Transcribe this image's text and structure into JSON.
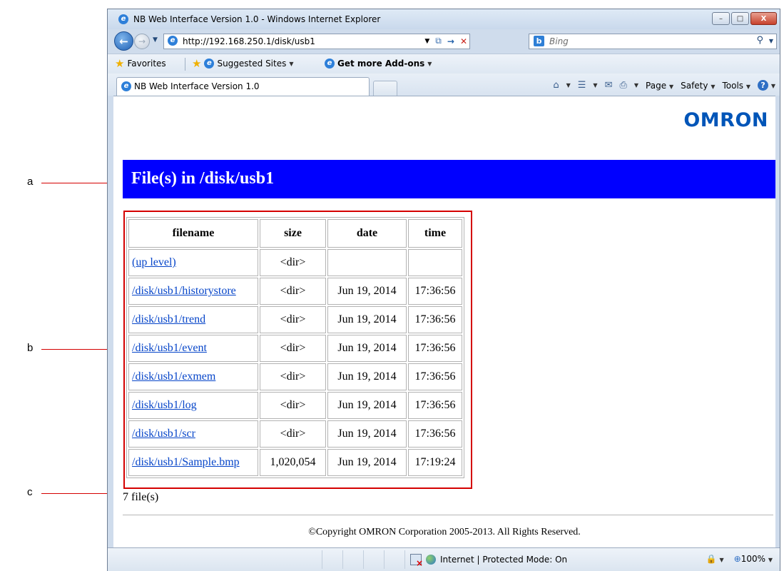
{
  "callouts": {
    "a": "a",
    "b": "b",
    "c": "c"
  },
  "window": {
    "title": "NB Web Interface Version 1.0 - Windows Internet Explorer",
    "controls": {
      "minimize": "–",
      "maximize": "□",
      "close": "X"
    }
  },
  "address_bar": {
    "url": "http://192.168.250.1/disk/usb1",
    "search_placeholder": "Bing"
  },
  "favorites_bar": {
    "favorites_label": "Favorites",
    "suggested_sites_label": "Suggested Sites",
    "addons_label": "Get more Add-ons"
  },
  "tabs": [
    {
      "label": "NB Web Interface Version 1.0",
      "active": true
    }
  ],
  "command_bar": {
    "page_label": "Page",
    "safety_label": "Safety",
    "tools_label": "Tools"
  },
  "page": {
    "logo": "OMRON",
    "heading": "File(s) in /disk/usb1",
    "table": {
      "headers": [
        "filename",
        "size",
        "date",
        "time"
      ],
      "rows": [
        {
          "filename": "(up level)",
          "size": "<dir>",
          "date": "",
          "time": ""
        },
        {
          "filename": "/disk/usb1/historystore",
          "size": "<dir>",
          "date": "Jun 19, 2014",
          "time": "17:36:56"
        },
        {
          "filename": "/disk/usb1/trend",
          "size": "<dir>",
          "date": "Jun 19, 2014",
          "time": "17:36:56"
        },
        {
          "filename": "/disk/usb1/event",
          "size": "<dir>",
          "date": "Jun 19, 2014",
          "time": "17:36:56"
        },
        {
          "filename": "/disk/usb1/exmem",
          "size": "<dir>",
          "date": "Jun 19, 2014",
          "time": "17:36:56"
        },
        {
          "filename": "/disk/usb1/log",
          "size": "<dir>",
          "date": "Jun 19, 2014",
          "time": "17:36:56"
        },
        {
          "filename": "/disk/usb1/scr",
          "size": "<dir>",
          "date": "Jun 19, 2014",
          "time": "17:36:56"
        },
        {
          "filename": "/disk/usb1/Sample.bmp",
          "size": "1,020,054",
          "date": "Jun 19, 2014",
          "time": "17:19:24"
        }
      ]
    },
    "file_count": "7 file(s)",
    "copyright": "©Copyright OMRON Corporation 2005-2013. All Rights Reserved."
  },
  "status_bar": {
    "zone": "Internet | Protected Mode: On",
    "zoom": "100%"
  },
  "colors": {
    "banner": "#0000ff",
    "callout_line": "#d40000",
    "logo": "#0055b8",
    "link": "#0645c9"
  }
}
